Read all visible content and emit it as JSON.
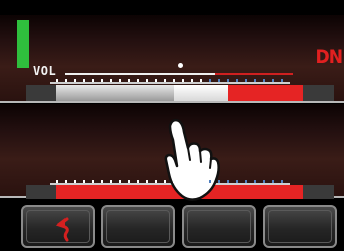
{
  "screen": {
    "vol_label": "VOL",
    "mode_badge": "DN"
  },
  "volume": {
    "level_fraction": 0.74
  },
  "meter_top": {
    "segments": [
      "silver",
      "white",
      "red"
    ]
  },
  "meter_bottom": {
    "segments": [
      "red"
    ]
  },
  "softkeys": [
    {
      "icon": "back-arrow-icon",
      "label": ""
    },
    {
      "icon": "",
      "label": ""
    },
    {
      "icon": "",
      "label": ""
    },
    {
      "icon": "",
      "label": ""
    }
  ],
  "overlay": {
    "icon": "tap-hand-icon"
  },
  "colors": {
    "signal": "#2fbf3d",
    "alert_red": "#e02020",
    "meter_red": "#e52424",
    "scale_blue": "#5080c0"
  }
}
